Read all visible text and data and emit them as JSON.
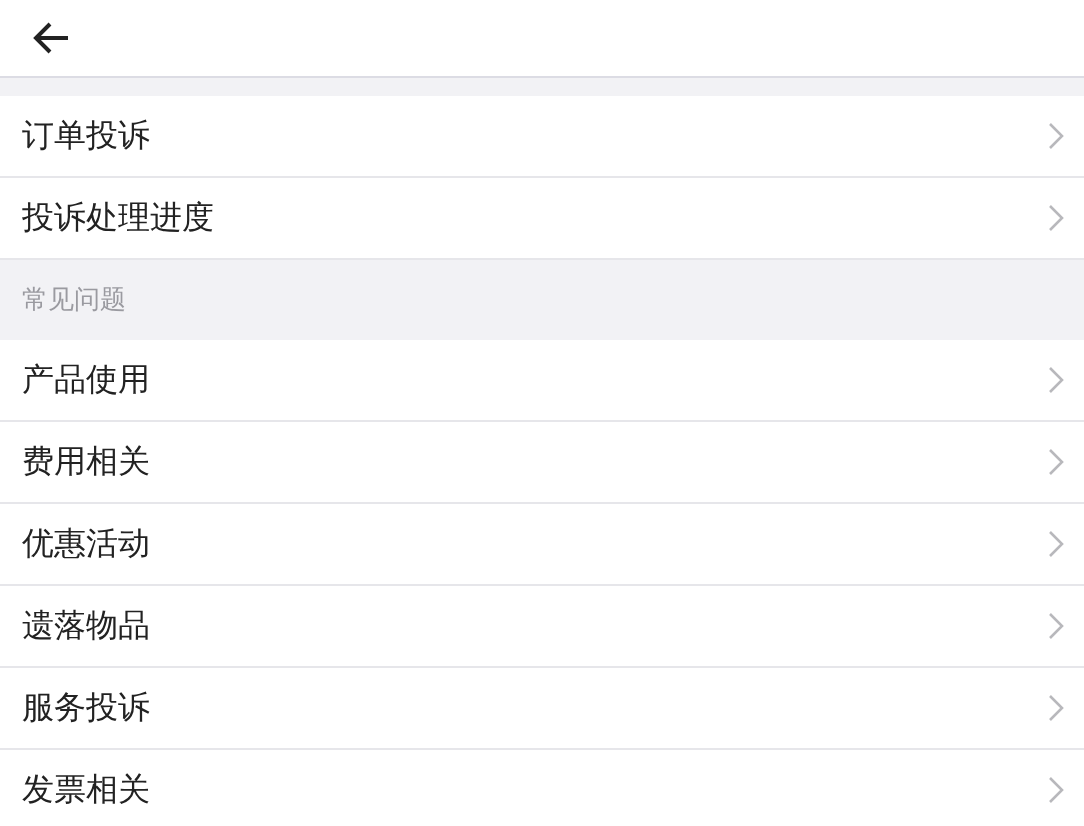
{
  "groups": [
    {
      "items": [
        "订单投诉",
        "投诉处理进度"
      ]
    },
    {
      "title": "常见问题",
      "items": [
        "产品使用",
        "费用相关",
        "优惠活动",
        "遗落物品",
        "服务投诉",
        "发票相关"
      ]
    }
  ]
}
